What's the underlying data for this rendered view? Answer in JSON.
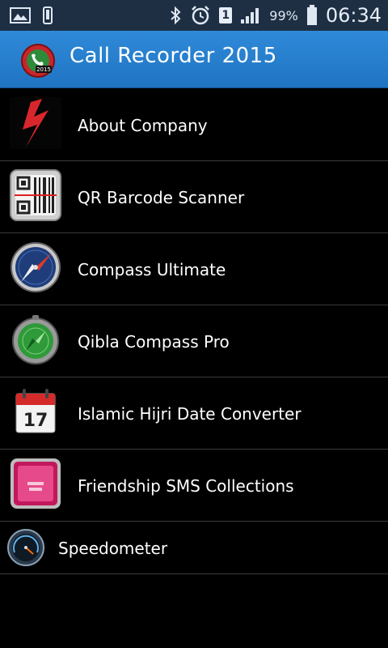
{
  "status_bar": {
    "battery_percent": "99%",
    "time": "06:34",
    "notification_count": "1"
  },
  "app_bar": {
    "title": "Call Recorder 2015",
    "logo_badge": "2015"
  },
  "apps": [
    {
      "label": "About Company",
      "icon": "company-logo-icon"
    },
    {
      "label": "QR Barcode Scanner",
      "icon": "qr-scanner-icon"
    },
    {
      "label": "Compass Ultimate",
      "icon": "compass-icon"
    },
    {
      "label": "Qibla Compass Pro",
      "icon": "qibla-compass-icon"
    },
    {
      "label": "Islamic Hijri Date Converter",
      "icon": "calendar-icon",
      "calendar_day": "17"
    },
    {
      "label": "Friendship SMS Collections",
      "icon": "friendship-sms-icon"
    },
    {
      "label": "Speedometer",
      "icon": "speedometer-icon"
    }
  ]
}
